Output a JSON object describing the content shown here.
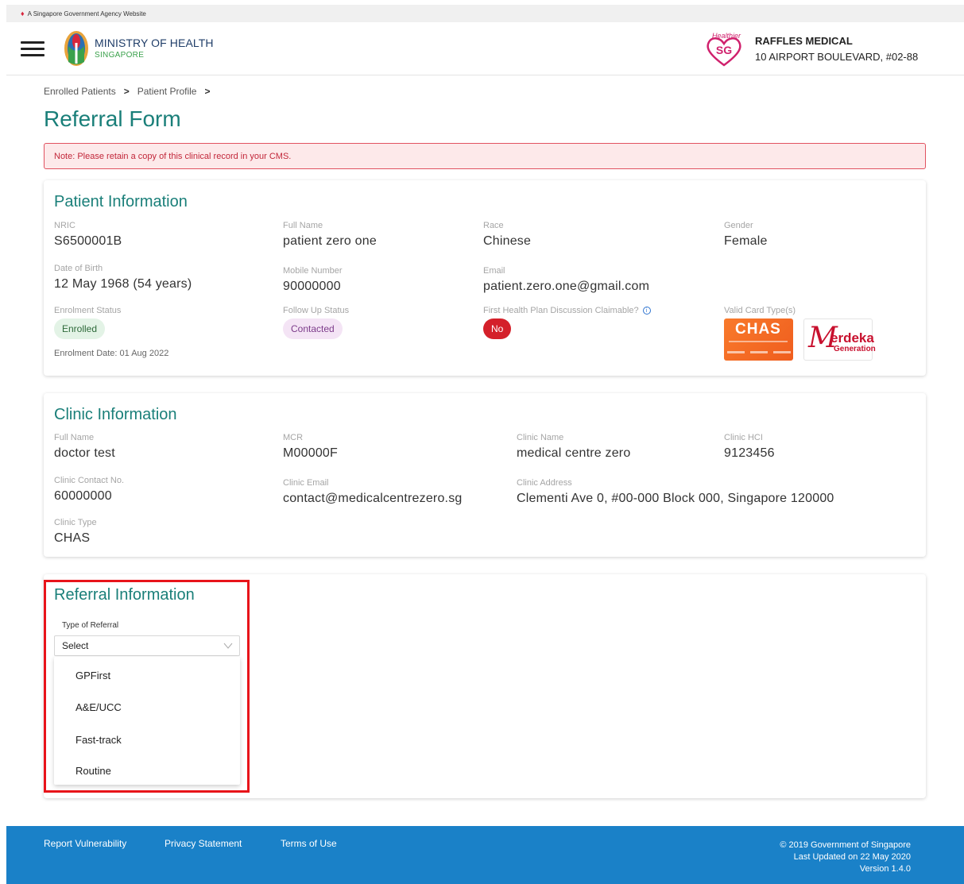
{
  "gov_bar": {
    "text": "A Singapore Government Agency Website"
  },
  "header": {
    "org_title": "MINISTRY OF HEALTH",
    "org_sub": "SINGAPORE",
    "clinic_name": "RAFFLES MEDICAL",
    "clinic_address": "10 AIRPORT BOULEVARD, #02-88",
    "healthier_text": "Healthier",
    "healthier_sg": "SG"
  },
  "breadcrumb": {
    "items": [
      "Enrolled Patients",
      "Patient Profile"
    ],
    "separator": ">"
  },
  "page_title": "Referral Form",
  "note": "Note: Please retain a copy of this clinical record in your CMS.",
  "patient_info": {
    "title": "Patient Information",
    "nric": {
      "label": "NRIC",
      "value": "S6500001B"
    },
    "full_name": {
      "label": "Full Name",
      "value": "patient zero one"
    },
    "race": {
      "label": "Race",
      "value": "Chinese"
    },
    "gender": {
      "label": "Gender",
      "value": "Female"
    },
    "dob": {
      "label": "Date of Birth",
      "value": "12 May 1968 (54 years)"
    },
    "mobile": {
      "label": "Mobile Number",
      "value": "90000000"
    },
    "email": {
      "label": "Email",
      "value": "patient.zero.one@gmail.com"
    },
    "enrolment_status": {
      "label": "Enrolment Status",
      "value": "Enrolled"
    },
    "follow_up_status": {
      "label": "Follow Up Status",
      "value": "Contacted"
    },
    "fhpd_claimable": {
      "label": "First Health Plan Discussion Claimable?",
      "value": "No"
    },
    "valid_card_types": {
      "label": "Valid Card Type(s)",
      "cards": [
        "CHAS",
        "Merdeka Generation"
      ]
    },
    "chas_card_text": "CHAS",
    "merdeka_m": "M",
    "merdeka_rest": "erdeka",
    "merdeka_gen": "Generation",
    "enrolment_date": "Enrolment Date: 01 Aug 2022"
  },
  "clinic_info": {
    "title": "Clinic Information",
    "full_name": {
      "label": "Full Name",
      "value": "doctor test"
    },
    "mcr": {
      "label": "MCR",
      "value": "M00000F"
    },
    "clinic_name": {
      "label": "Clinic Name",
      "value": "medical centre zero"
    },
    "clinic_hci": {
      "label": "Clinic HCI",
      "value": "9123456"
    },
    "contact_no": {
      "label": "Clinic Contact No.",
      "value": "60000000"
    },
    "clinic_email": {
      "label": "Clinic Email",
      "value": "contact@medicalcentrezero.sg"
    },
    "clinic_address": {
      "label": "Clinic Address",
      "value": "Clementi Ave 0, #00-000 Block 000, Singapore 120000"
    },
    "clinic_type": {
      "label": "Clinic Type",
      "value": "CHAS"
    }
  },
  "referral_info": {
    "title": "Referral Information",
    "type_label": "Type of Referral",
    "select_value": "Select",
    "options": [
      "GPFirst",
      "A&E/UCC",
      "Fast-track",
      "Routine"
    ]
  },
  "footer": {
    "links": [
      "Report Vulnerability",
      "Privacy Statement",
      "Terms of Use"
    ],
    "copyright": "© 2019 Government of Singapore",
    "last_updated": "Last Updated on 22 May 2020",
    "version": "Version 1.4.0"
  },
  "colors": {
    "accent": "#1a7f79",
    "note_bg": "#fde9ea",
    "note_border": "#e15260",
    "no_badge": "#d4202a",
    "footer_bg": "#1a81c8",
    "highlight": "#e8141a"
  },
  "icons": [
    "hamburger-menu-icon",
    "moh-logo",
    "healthier-sg-logo",
    "info-icon",
    "chevron-down-icon",
    "lion-head-icon"
  ]
}
